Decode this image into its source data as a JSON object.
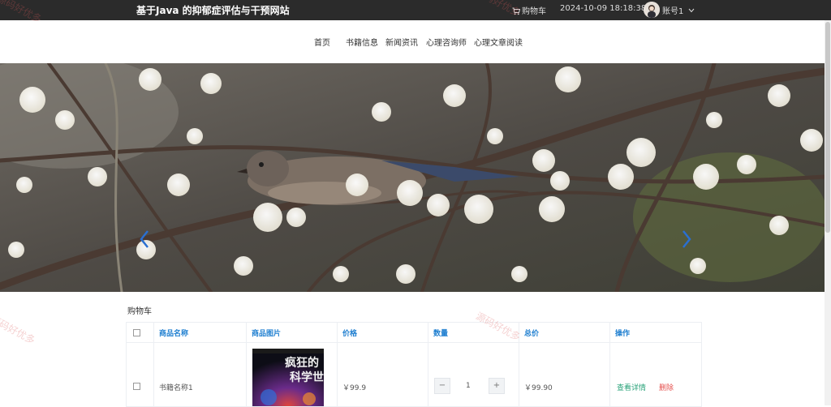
{
  "header": {
    "title": "基于Java 的抑郁症评估与干预网站",
    "cart_label": "购物车",
    "datetime": "2024-10-09  18:18:38",
    "account_label": "账号1"
  },
  "nav": {
    "items": [
      "首页",
      "书籍信息",
      "新闻资讯",
      "心理咨询师",
      "心理文章阅读"
    ]
  },
  "banner": {
    "image": "plum-blossom-bird-photo"
  },
  "cart": {
    "heading": "购物车",
    "columns": [
      "商品名称",
      "商品图片",
      "价格",
      "数量",
      "总价",
      "操作"
    ],
    "rows": [
      {
        "name": "书籍名称1",
        "price": "￥99.9",
        "quantity": "1",
        "total": "￥99.90",
        "detail_label": "查看详情",
        "delete_label": "删除",
        "cover_title": "疯狂的科学世界"
      }
    ]
  },
  "watermarks": [
    "源码好优多",
    "源码好优多",
    "源码好优多"
  ],
  "colors": {
    "topbar": "#2b2b2b",
    "header_text": "#1f7fd0",
    "detail_link": "#2aa37a",
    "delete_link": "#e5504e"
  }
}
